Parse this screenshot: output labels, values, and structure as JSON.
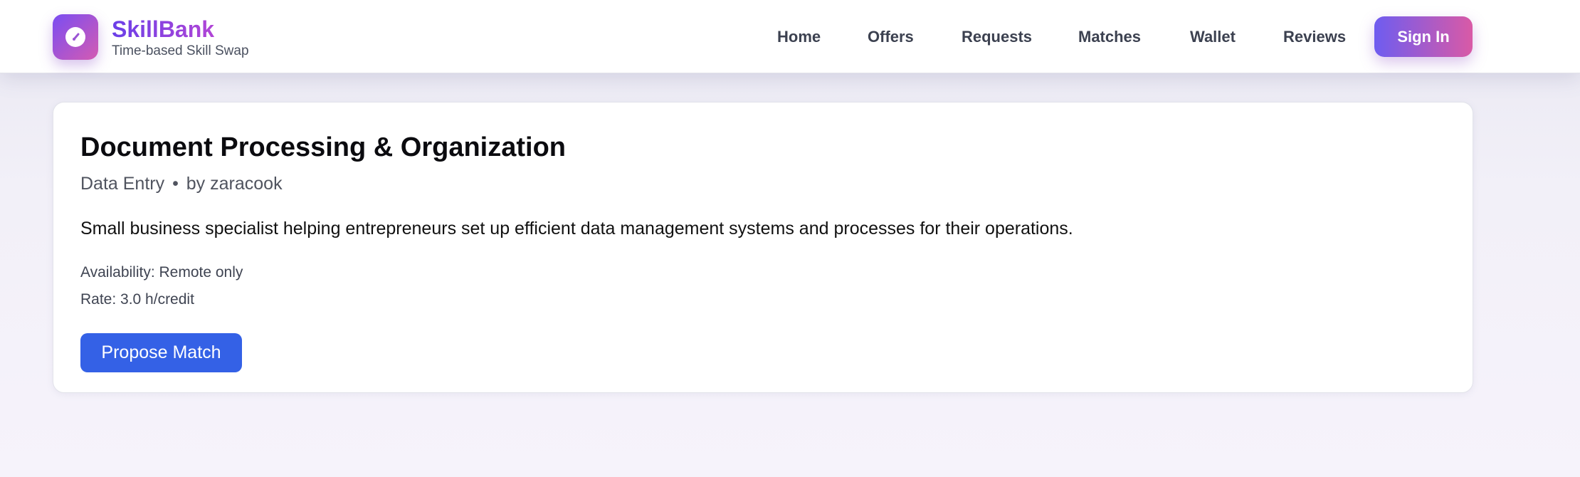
{
  "app": {
    "name": "SkillBank",
    "tagline": "Time-based Skill Swap",
    "logo_icon": "gauge-icon",
    "brand_gradient": [
      "#6a3fe8",
      "#b145d6"
    ]
  },
  "nav": {
    "items": [
      {
        "label": "Home"
      },
      {
        "label": "Offers"
      },
      {
        "label": "Requests"
      },
      {
        "label": "Matches"
      },
      {
        "label": "Wallet"
      },
      {
        "label": "Reviews"
      }
    ],
    "sign_in_label": "Sign In",
    "sign_in_gradient": [
      "#6e5cf0",
      "#d95aa6"
    ]
  },
  "offer": {
    "title": "Document Processing & Organization",
    "category": "Data Entry",
    "separator": "•",
    "author": "by zaracook",
    "description": "Small business specialist helping entrepreneurs set up efficient data management systems and processes for their operations.",
    "availability": "Availability: Remote only",
    "rate": "Rate: 3.0 h/credit",
    "propose_label": "Propose Match",
    "accent": "#3461e6"
  }
}
